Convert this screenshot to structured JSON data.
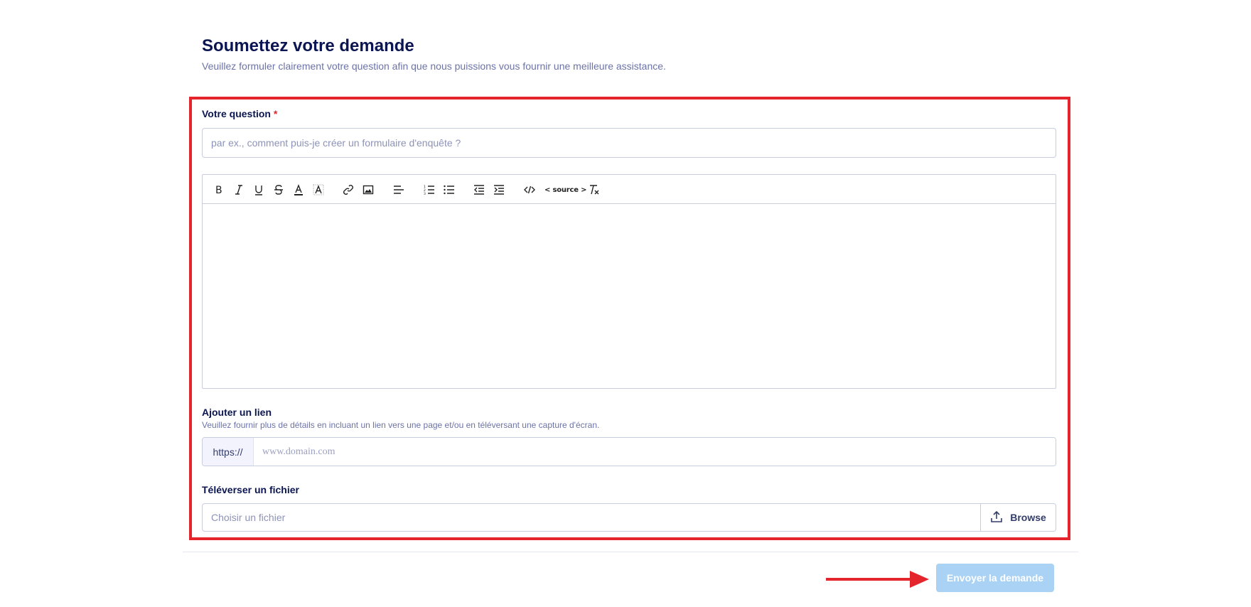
{
  "header": {
    "title": "Soumettez votre demande",
    "subtitle": "Veuillez formuler clairement votre question afin que nous puissions vous fournir une meilleure assistance."
  },
  "question": {
    "label": "Votre question",
    "required_mark": "*",
    "placeholder": "par ex., comment puis-je créer un formulaire d'enquête ?"
  },
  "editor": {
    "toolbar": {
      "source_label": "< source >"
    },
    "toolbar_icons": [
      "bold-icon",
      "italic-icon",
      "underline-icon",
      "strikethrough-icon",
      "text-color-icon",
      "background-color-icon",
      "link-icon",
      "image-icon",
      "align-left-icon",
      "ordered-list-icon",
      "unordered-list-icon",
      "outdent-icon",
      "indent-icon",
      "code-icon",
      "source-icon",
      "clear-format-icon"
    ]
  },
  "link": {
    "label": "Ajouter un lien",
    "description": "Veuillez fournir plus de détails en incluant un lien vers une page et/ou en téléversant une capture d'écran.",
    "prefix": "https://",
    "placeholder": "www.domain.com"
  },
  "file": {
    "label": "Téléverser un fichier",
    "placeholder": "Choisir un fichier",
    "browse_label": "Browse"
  },
  "submit": {
    "label": "Envoyer la demande"
  },
  "colors": {
    "highlight_frame": "#e4252b",
    "title": "#0a1551",
    "subtitle": "#6c73a8",
    "submit_disabled": "#a9d2f5",
    "arrow": "#e4252b"
  }
}
